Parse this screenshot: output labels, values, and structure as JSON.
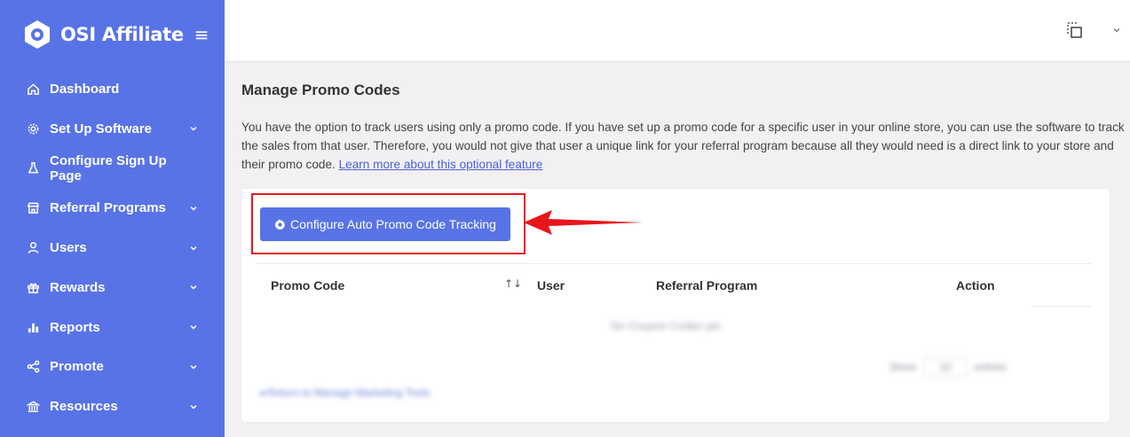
{
  "brand": {
    "name": "OSI Affiliate",
    "menu_icon": "hamburger-icon"
  },
  "sidebar": {
    "items": [
      {
        "label": "Dashboard",
        "icon": "home-icon",
        "has_chevron": false
      },
      {
        "label": "Set Up Software",
        "icon": "gear-icon",
        "has_chevron": true
      },
      {
        "label": "Configure Sign Up Page",
        "icon": "flask-icon",
        "has_chevron": false
      },
      {
        "label": "Referral Programs",
        "icon": "store-icon",
        "has_chevron": true
      },
      {
        "label": "Users",
        "icon": "user-icon",
        "has_chevron": true
      },
      {
        "label": "Rewards",
        "icon": "gift-icon",
        "has_chevron": true
      },
      {
        "label": "Reports",
        "icon": "bar-chart-icon",
        "has_chevron": true
      },
      {
        "label": "Promote",
        "icon": "share-icon",
        "has_chevron": true
      },
      {
        "label": "Resources",
        "icon": "bank-icon",
        "has_chevron": true
      }
    ]
  },
  "topbar": {
    "icon": "grid-dashed-icon",
    "chevron": "chevron-down-icon"
  },
  "main": {
    "title": "Manage Promo Codes",
    "intro_text": "You have the option to track users using only a promo code. If you have set up a promo code for a specific user in your online store, you can use the software to track the sales from that user. Therefore, you would not give that user a unique link for your referral program because all they would need is a direct link to your store and their promo code.",
    "intro_link": "Learn more about this optional feature",
    "configure_button": "Configure Auto Promo Code Tracking",
    "table": {
      "headers": [
        "Promo Code",
        "User",
        "Referral Program",
        "Action"
      ],
      "empty_text": "No Coupon Codes yet",
      "show_label": "Show",
      "entries_value": "10",
      "entries_label": "entries"
    },
    "back_link": "Return to Manage Marketing Tools"
  },
  "colors": {
    "sidebar": "#5873e6",
    "accent": "#5873e6",
    "highlight": "#e8151b",
    "link": "#4a62d4"
  }
}
